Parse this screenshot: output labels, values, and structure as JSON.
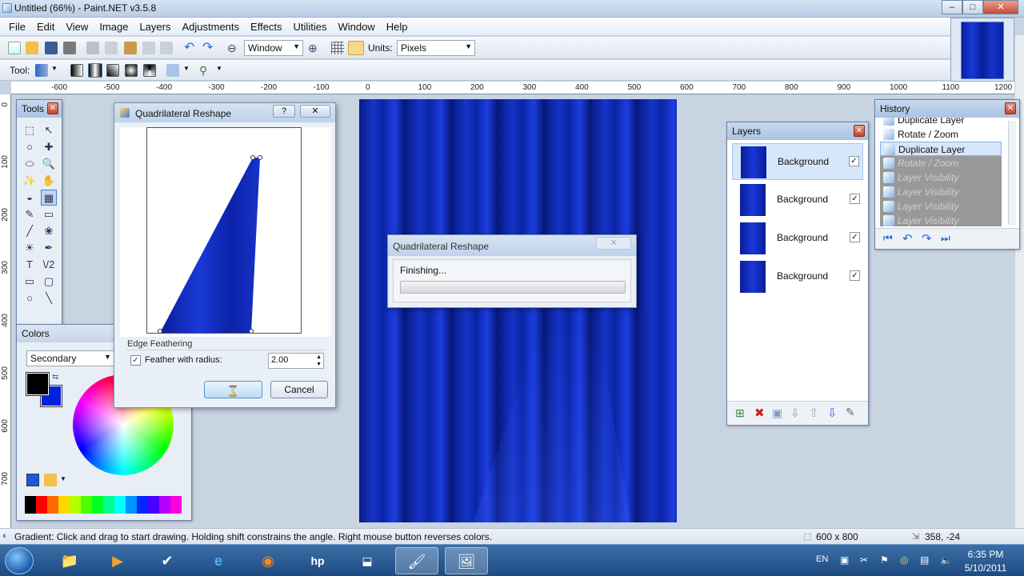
{
  "window": {
    "title": "Untitled (66%) - Paint.NET v3.5.8"
  },
  "menu": [
    "File",
    "Edit",
    "View",
    "Image",
    "Layers",
    "Adjustments",
    "Effects",
    "Utilities",
    "Window",
    "Help"
  ],
  "toolbar": {
    "zoom_value": "Window",
    "units_label": "Units:",
    "units_value": "Pixels",
    "tool_label": "Tool:"
  },
  "ruler": {
    "h_ticks": [
      "-600",
      "-500",
      "-400",
      "-300",
      "-200",
      "-100",
      "0",
      "100",
      "200",
      "300",
      "400",
      "500",
      "600",
      "700",
      "800",
      "900",
      "1000",
      "1100",
      "1200"
    ],
    "v_ticks": [
      "0",
      "100",
      "200",
      "300",
      "400",
      "500",
      "600",
      "700"
    ]
  },
  "tools_panel": {
    "title": "Tools",
    "icons": [
      "⬚",
      "↖",
      "○",
      "✚",
      "⬭",
      "🔍",
      "✨",
      "✋",
      "◒",
      "▦",
      "✎",
      "▭",
      "╱",
      "❀",
      "☀",
      "✒",
      "T",
      "\\/2",
      "▭",
      "▢",
      "○",
      "╲"
    ]
  },
  "colors_panel": {
    "title": "Colors",
    "mode": "Secondary",
    "primary": "#000000",
    "secondary": "#0022dd",
    "palette": [
      "#000000",
      "#ff0000",
      "#ff6a00",
      "#ffd800",
      "#b6ff00",
      "#4cff00",
      "#00ff21",
      "#00ff90",
      "#00ffff",
      "#0094ff",
      "#0026ff",
      "#4800ff",
      "#b200ff",
      "#ff00dc"
    ]
  },
  "quad_dialog": {
    "title": "Quadrilateral Reshape",
    "help_btn": "?",
    "section": "Edge Feathering",
    "feather_label": "Feather with radius:",
    "feather_checked": true,
    "feather_value": "2.00",
    "ok_label": "",
    "cancel_label": "Cancel"
  },
  "progress_dialog": {
    "title": "Quadrilateral Reshape",
    "status": "Finishing...",
    "progress": 0
  },
  "layers_panel": {
    "title": "Layers",
    "layers": [
      {
        "name": "Background",
        "visible": true,
        "selected": true
      },
      {
        "name": "Background",
        "visible": true,
        "selected": false
      },
      {
        "name": "Background",
        "visible": true,
        "selected": false
      },
      {
        "name": "Background",
        "visible": true,
        "selected": false
      }
    ]
  },
  "history_panel": {
    "title": "History",
    "items": [
      {
        "label": "Duplicate Layer",
        "state": "done"
      },
      {
        "label": "Rotate / Zoom",
        "state": "done"
      },
      {
        "label": "Duplicate Layer",
        "state": "current"
      },
      {
        "label": "Rotate / Zoom",
        "state": "undone"
      },
      {
        "label": "Layer Visibility",
        "state": "undone"
      },
      {
        "label": "Layer Visibility",
        "state": "undone"
      },
      {
        "label": "Layer Visibility",
        "state": "undone"
      },
      {
        "label": "Layer Visibility",
        "state": "undone"
      }
    ]
  },
  "status": {
    "text": "Gradient: Click and drag to start drawing. Holding shift constrains the angle. Right mouse button reverses colors.",
    "size": "600 x 800",
    "coords": "358, -24"
  },
  "taskbar": {
    "lang": "EN",
    "time": "6:35 PM",
    "date": "5/10/2011"
  }
}
